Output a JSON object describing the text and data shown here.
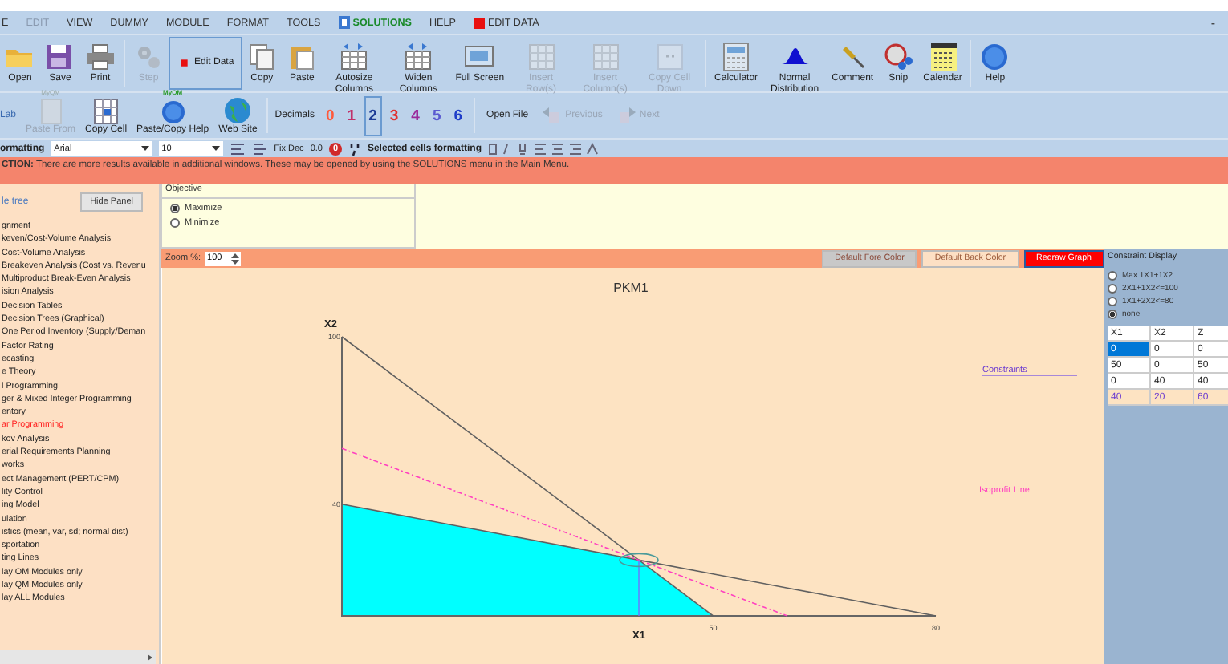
{
  "menu": [
    {
      "label": "E",
      "kind": "plain",
      "disabled": false
    },
    {
      "label": "EDIT",
      "kind": "plain",
      "disabled": true
    },
    {
      "label": "VIEW",
      "kind": "plain",
      "disabled": false
    },
    {
      "label": "DUMMY",
      "kind": "plain",
      "disabled": false
    },
    {
      "label": "MODULE",
      "kind": "plain",
      "disabled": false
    },
    {
      "label": "FORMAT",
      "kind": "plain",
      "disabled": false
    },
    {
      "label": "TOOLS",
      "kind": "plain",
      "disabled": false
    },
    {
      "label": "SOLUTIONS",
      "kind": "solutions",
      "disabled": false
    },
    {
      "label": "HELP",
      "kind": "plain",
      "disabled": false
    },
    {
      "label": "EDIT DATA",
      "kind": "edit-data",
      "disabled": false
    }
  ],
  "window_control": "-",
  "toolbar": [
    {
      "label": "Open",
      "disabled": false,
      "selected": false
    },
    {
      "label": "Save",
      "disabled": false,
      "selected": false
    },
    {
      "label": "Print",
      "disabled": false,
      "selected": false
    },
    {
      "label": "Step",
      "disabled": true,
      "selected": false
    },
    {
      "label": "Edit Data",
      "disabled": false,
      "selected": true
    },
    {
      "label": "Copy",
      "disabled": false,
      "selected": false
    },
    {
      "label": "Paste",
      "disabled": false,
      "selected": false
    },
    {
      "label": "Autosize Columns",
      "disabled": false,
      "selected": false
    },
    {
      "label": "Widen Columns",
      "disabled": false,
      "selected": false
    },
    {
      "label": "Full Screen",
      "disabled": false,
      "selected": false
    },
    {
      "label": "Insert Row(s)",
      "disabled": true,
      "selected": false
    },
    {
      "label": "Insert Column(s)",
      "disabled": true,
      "selected": false
    },
    {
      "label": "Copy Cell Down",
      "disabled": true,
      "selected": false
    },
    {
      "label": "Calculator",
      "disabled": false,
      "selected": false
    },
    {
      "label": "Normal Distribution",
      "disabled": false,
      "selected": false
    },
    {
      "label": "Comment",
      "disabled": false,
      "selected": false
    },
    {
      "label": "Snip",
      "disabled": false,
      "selected": false
    },
    {
      "label": "Calendar",
      "disabled": false,
      "selected": false
    },
    {
      "label": "Help",
      "disabled": false,
      "selected": false
    }
  ],
  "toolbar2": {
    "cut_label": "Lab",
    "buttons": [
      {
        "label": "Paste From",
        "badge": "MyQM",
        "disabled": true
      },
      {
        "label": "Copy Cell",
        "disabled": false
      },
      {
        "label": "Paste/Copy Help",
        "badge": "MyOM",
        "disabled": false
      },
      {
        "label": "Web Site",
        "disabled": false
      }
    ],
    "decimals_label": "Decimals",
    "decimals": [
      {
        "label": "0",
        "color": "#ff5a3c",
        "selected": false
      },
      {
        "label": "1",
        "color": "#c0306a",
        "selected": false
      },
      {
        "label": "2",
        "color": "#1e3c96",
        "selected": true
      },
      {
        "label": "3",
        "color": "#e03030",
        "selected": false
      },
      {
        "label": "4",
        "color": "#9a2a9a",
        "selected": false
      },
      {
        "label": "5",
        "color": "#5a5ad0",
        "selected": false
      },
      {
        "label": "6",
        "color": "#1e3cc8",
        "selected": false
      }
    ],
    "open_file": "Open File",
    "nav": [
      {
        "label": "Previous",
        "disabled": true
      },
      {
        "label": "Next",
        "disabled": true
      }
    ]
  },
  "format_bar": {
    "label": "ormatting",
    "font": "Arial",
    "size": "10",
    "fix_dec": "Fix Dec",
    "dec_value": "0.0",
    "zero_button": "0",
    "cells_label": "Selected cells formatting"
  },
  "instruction": "**CTION:** There are more results available in additional windows. These may be opened by using the SOLUTIONS menu in the Main Menu.",
  "module_tree": {
    "title": "le tree",
    "hide_button": "Hide Panel",
    "items": [
      {
        "label": "gnment",
        "selected": false
      },
      {
        "label": "keven/Cost-Volume Analysis",
        "selected": false
      },
      {
        "label": "Cost-Volume Analysis",
        "selected": false
      },
      {
        "label": "Breakeven Analysis (Cost vs. Revenu",
        "selected": false
      },
      {
        "label": "Multiproduct Break-Even Analysis",
        "selected": false
      },
      {
        "label": "ision Analysis",
        "selected": false
      },
      {
        "label": "Decision Tables",
        "selected": false
      },
      {
        "label": "Decision Trees (Graphical)",
        "selected": false
      },
      {
        "label": "One Period Inventory (Supply/Deman",
        "selected": false
      },
      {
        "label": "Factor Rating",
        "selected": false
      },
      {
        "label": "ecasting",
        "selected": false
      },
      {
        "label": "e Theory",
        "selected": false
      },
      {
        "label": "l Programming",
        "selected": false
      },
      {
        "label": "ger & Mixed Integer Programming",
        "selected": false
      },
      {
        "label": "entory",
        "selected": false
      },
      {
        "label": "ar Programming",
        "selected": true
      },
      {
        "label": "kov Analysis",
        "selected": false
      },
      {
        "label": "erial Requirements Planning",
        "selected": false
      },
      {
        "label": "works",
        "selected": false
      },
      {
        "label": "ect Management (PERT/CPM)",
        "selected": false
      },
      {
        "label": "lity Control",
        "selected": false
      },
      {
        "label": "ing Model",
        "selected": false
      },
      {
        "label": "ulation",
        "selected": false
      },
      {
        "label": "istics (mean, var, sd; normal dist)",
        "selected": false
      },
      {
        "label": "sportation",
        "selected": false
      },
      {
        "label": "ting Lines",
        "selected": false
      },
      {
        "label": "lay OM Modules only",
        "selected": false
      },
      {
        "label": "lay QM Modules only",
        "selected": false
      },
      {
        "label": "lay ALL Modules",
        "selected": false
      }
    ]
  },
  "objective": {
    "title": "Objective",
    "options": [
      {
        "label": "Maximize",
        "selected": true
      },
      {
        "label": "Minimize",
        "selected": false
      }
    ]
  },
  "graph_bar": {
    "zoom_label": "Zoom %:",
    "zoom_value": "100",
    "buttons": [
      {
        "label": "Default Fore Color",
        "kind": "fore"
      },
      {
        "label": "Default Back Color",
        "kind": "back"
      },
      {
        "label": "Redraw Graph",
        "kind": "redraw"
      }
    ]
  },
  "graph": {
    "constraints_label": "Constraints",
    "isoprofit_label": "Isoprofit Line",
    "chart_data": {
      "type": "line",
      "title": "PKM1",
      "xlabel": "X1",
      "ylabel": "X2",
      "x": [
        0,
        40,
        50,
        60,
        80
      ],
      "series": [
        {
          "line_style": "solid",
          "color": "#606060",
          "values": [
            100,
            20,
            0,
            null,
            null
          ]
        },
        {
          "line_style": "solid",
          "color": "#606060",
          "values": [
            40,
            20,
            15,
            10,
            0
          ]
        },
        {
          "line_style": "dashed",
          "color": "#ff40c0",
          "values": [
            60,
            20,
            10,
            0,
            null
          ]
        }
      ],
      "xlim": [
        0,
        80
      ],
      "ylim": [
        0,
        100
      ],
      "xticks": [
        50,
        80
      ],
      "yticks": [
        40,
        100
      ]
    }
  },
  "constraint_display": {
    "title": "Constraint Display",
    "options": [
      {
        "label": "Max 1X1+1X2",
        "selected": false
      },
      {
        "label": "2X1+1X2<=100",
        "selected": false
      },
      {
        "label": "1X1+2X2<=80",
        "selected": false
      },
      {
        "label": "none",
        "selected": true
      }
    ],
    "columns": [
      "X1",
      "X2",
      "Z"
    ],
    "rows": [
      {
        "cells": [
          {
            "text": "0",
            "selected": true
          },
          {
            "text": "0",
            "selected": false
          },
          {
            "text": "0",
            "selected": false
          }
        ],
        "optimal": false
      },
      {
        "cells": [
          {
            "text": "50",
            "selected": false
          },
          {
            "text": "0",
            "selected": false
          },
          {
            "text": "50",
            "selected": false
          }
        ],
        "optimal": false
      },
      {
        "cells": [
          {
            "text": "0",
            "selected": false
          },
          {
            "text": "40",
            "selected": false
          },
          {
            "text": "40",
            "selected": false
          }
        ],
        "optimal": false
      },
      {
        "cells": [
          {
            "text": "40",
            "selected": false
          },
          {
            "text": "20",
            "selected": false
          },
          {
            "text": "60",
            "selected": false
          }
        ],
        "optimal": true
      }
    ]
  }
}
